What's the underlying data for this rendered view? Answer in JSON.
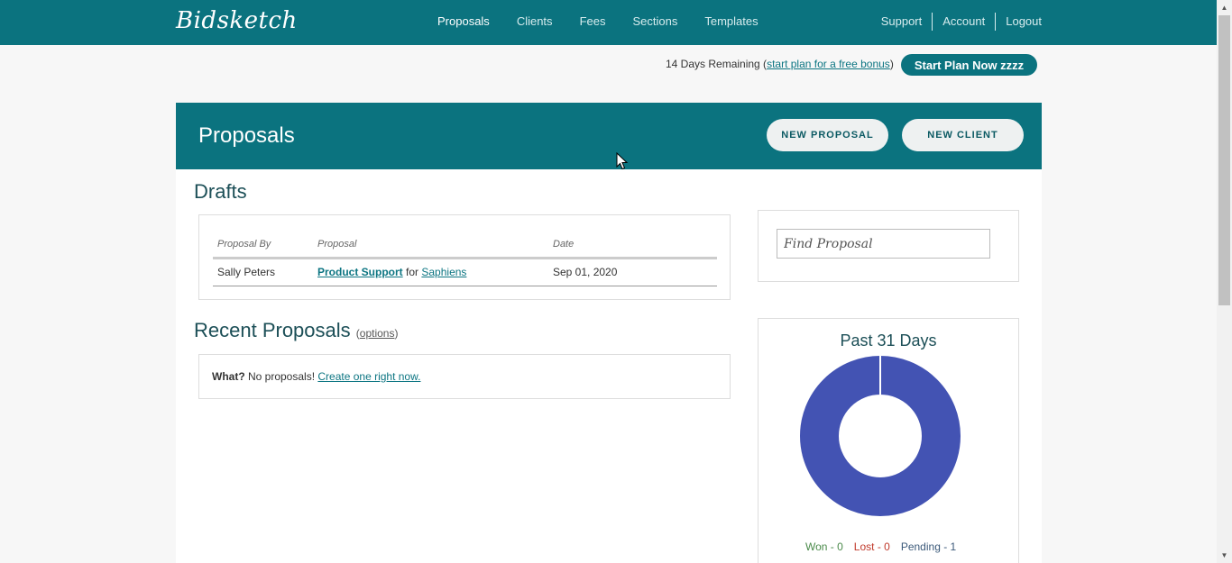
{
  "header": {
    "logo": "Bidsketch",
    "nav": [
      {
        "label": "Proposals",
        "active": true
      },
      {
        "label": "Clients",
        "active": false
      },
      {
        "label": "Fees",
        "active": false
      },
      {
        "label": "Sections",
        "active": false
      },
      {
        "label": "Templates",
        "active": false
      }
    ],
    "user_nav": [
      "Support",
      "Account",
      "Logout"
    ]
  },
  "trial": {
    "remaining": "14 Days Remaining (",
    "link": "start plan for a free bonus",
    "close": ")",
    "button": "Start Plan Now zzzz"
  },
  "panel": {
    "title": "Proposals",
    "new_proposal": "NEW PROPOSAL",
    "new_client": "NEW CLIENT"
  },
  "drafts": {
    "title": "Drafts",
    "columns": [
      "Proposal By",
      "Proposal",
      "Date"
    ],
    "rows": [
      {
        "by": "Sally Peters",
        "proposal": "Product Support",
        "for": "for",
        "client": "Saphiens",
        "date": "Sep 01, 2020"
      }
    ]
  },
  "recent": {
    "title": "Recent Proposals",
    "options_open": "(",
    "options": "options",
    "options_close": ")",
    "what": "What?",
    "message": " No proposals! ",
    "create": "Create one right now."
  },
  "search": {
    "placeholder": "Find Proposal"
  },
  "stats": {
    "title": "Past 31 Days",
    "won": "Won - 0",
    "lost": "Lost - 0",
    "pending": "Pending - 1",
    "colors": {
      "won": "#4a8a4a",
      "lost": "#c0392b",
      "pending": "#3c5a7a",
      "donut": "#4353b3"
    }
  },
  "chart_data": {
    "type": "pie",
    "categories": [
      "Won",
      "Lost",
      "Pending"
    ],
    "values": [
      0,
      0,
      1
    ]
  }
}
